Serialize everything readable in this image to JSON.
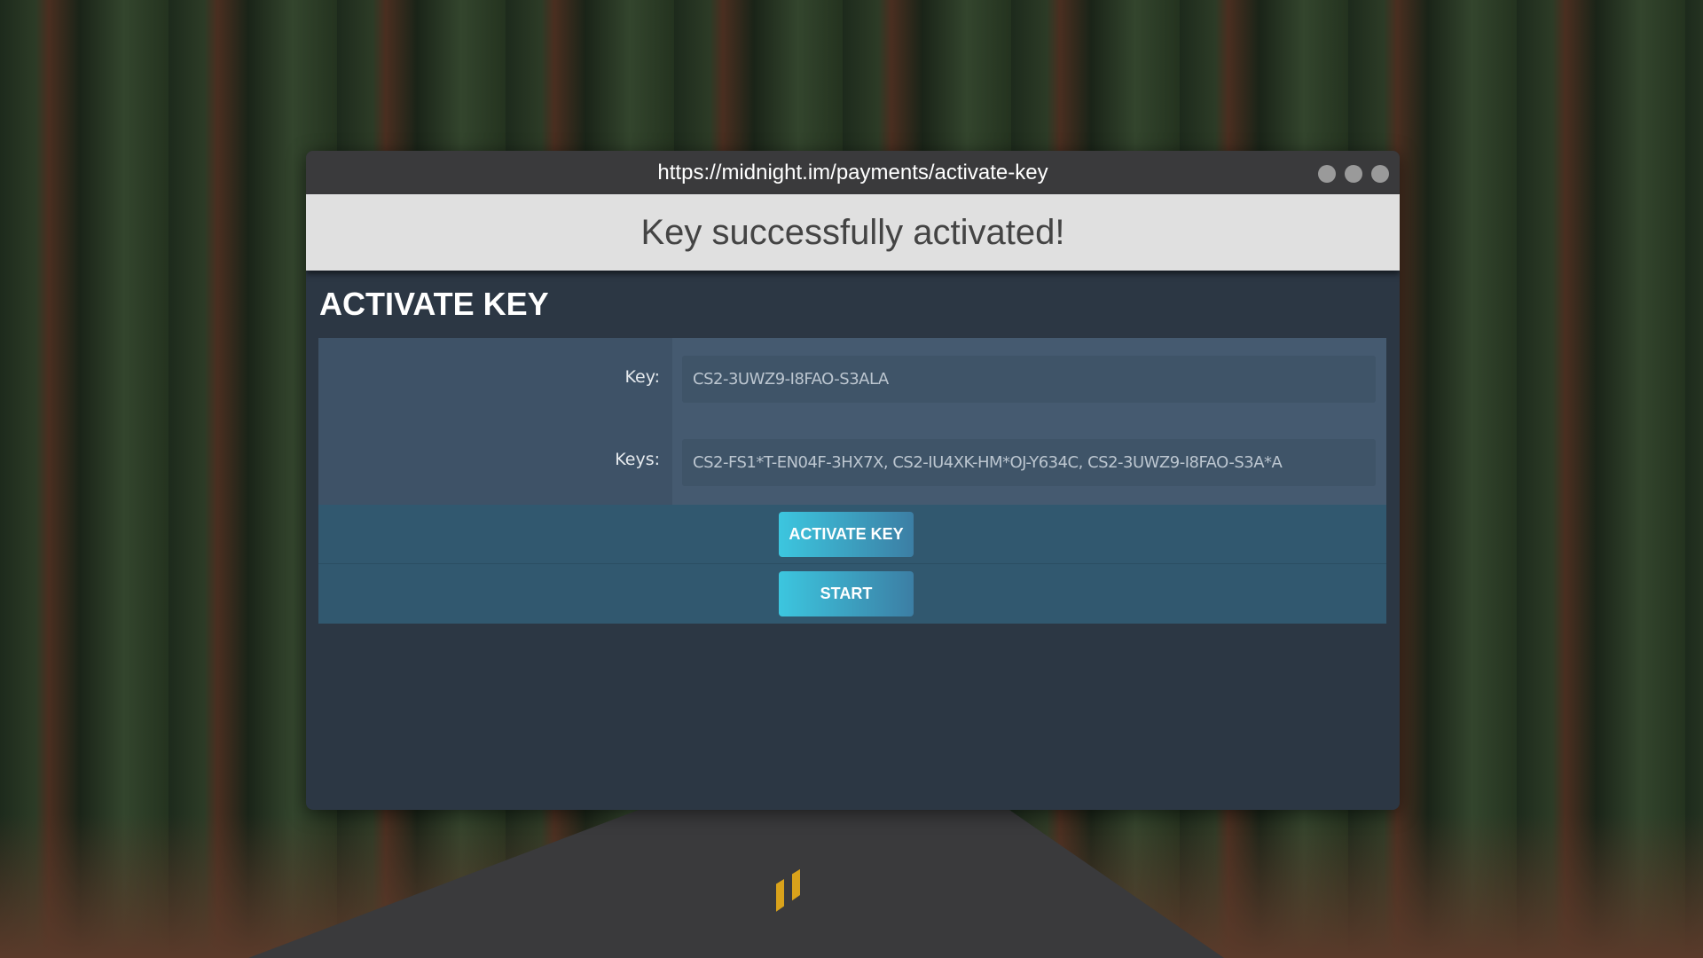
{
  "window": {
    "url": "https://midnight.im/payments/activate-key"
  },
  "banner": {
    "message": "Key successfully activated!"
  },
  "page": {
    "title": "ACTIVATE KEY"
  },
  "form": {
    "key_label": "Key:",
    "key_value": "CS2-3UWZ9-I8FAO-S3ALA",
    "keys_label": "Keys:",
    "keys_value": "CS2-FS1*T-EN04F-3HX7X, CS2-IU4XK-HM*OJ-Y634C, CS2-3UWZ9-I8FAO-S3A*A"
  },
  "buttons": {
    "activate": "ACTIVATE KEY",
    "start": "START"
  },
  "colors": {
    "button_gradient_start": "#3cc6df",
    "button_gradient_end": "#3c7ea4",
    "panel": "#455a70",
    "window_bg": "#2c3744"
  }
}
